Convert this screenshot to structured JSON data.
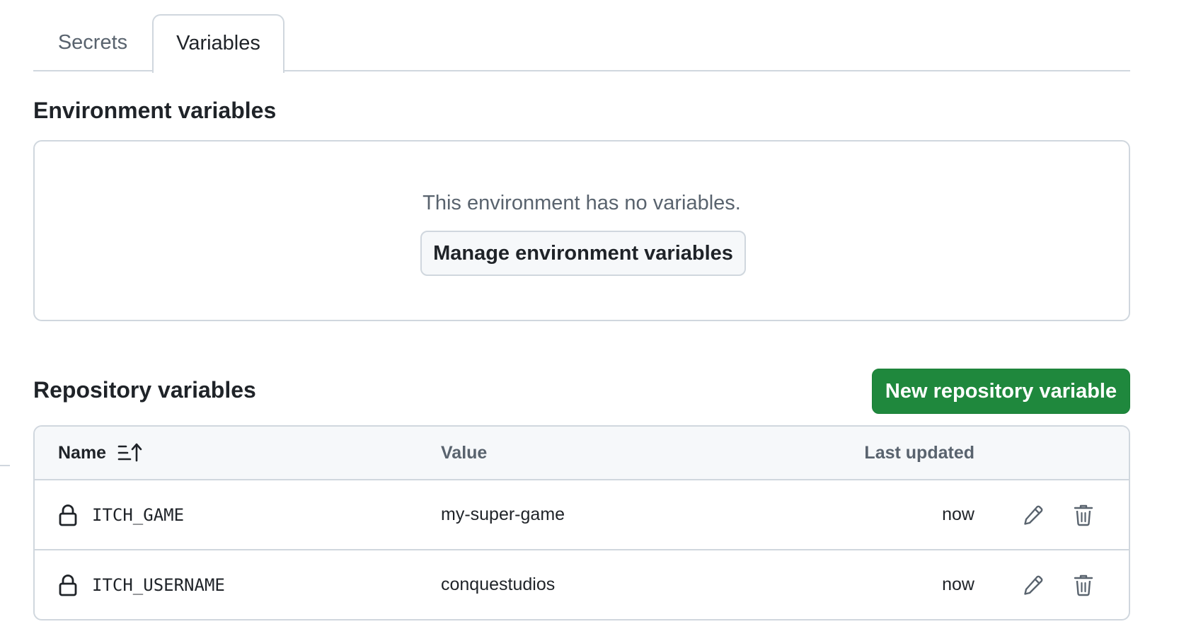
{
  "tabs": [
    {
      "label": "Secrets",
      "active": false
    },
    {
      "label": "Variables",
      "active": true
    }
  ],
  "environment": {
    "heading": "Environment variables",
    "empty_text": "This environment has no variables.",
    "manage_button_label": "Manage environment variables"
  },
  "repository": {
    "heading": "Repository variables",
    "new_button_label": "New repository variable",
    "columns": {
      "name": "Name",
      "value": "Value",
      "last_updated": "Last updated"
    },
    "rows": [
      {
        "name": "ITCH_GAME",
        "value": "my-super-game",
        "last_updated": "now"
      },
      {
        "name": "ITCH_USERNAME",
        "value": "conquestudios",
        "last_updated": "now"
      }
    ]
  },
  "colors": {
    "primary_button": "#1f883d",
    "border": "#d0d7de",
    "muted_text": "#59636e",
    "header_bg": "#f6f8fa"
  },
  "icons": {
    "sort": "sort-ascending-icon",
    "lock": "lock-icon",
    "edit": "pencil-icon",
    "delete": "trash-icon"
  }
}
